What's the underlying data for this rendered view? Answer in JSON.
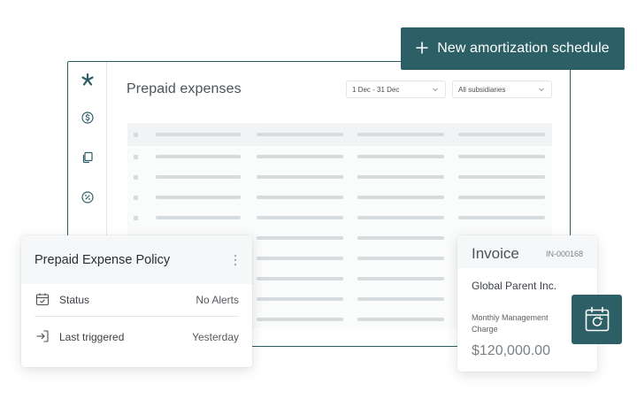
{
  "header": {
    "cta_label": "New amortization schedule",
    "cta_icon": "plus-icon",
    "accent_color": "#2c5f66"
  },
  "sidebar": {
    "items": [
      {
        "icon": "asterisk-logo-icon"
      },
      {
        "icon": "dollar-circle-icon"
      },
      {
        "icon": "copy-icon"
      },
      {
        "icon": "percent-circle-icon"
      }
    ]
  },
  "main": {
    "title": "Prepaid expenses",
    "date_filter": "1 Dec - 31 Dec",
    "subsidiary_filter": "All subsidiaries"
  },
  "policy_card": {
    "title": "Prepaid Expense Policy",
    "rows": [
      {
        "label": "Status",
        "value": "No Alerts",
        "icon": "calendar-check-icon"
      },
      {
        "label": "Last triggered",
        "value": "Yesterday",
        "icon": "sign-in-icon"
      }
    ]
  },
  "invoice_card": {
    "title": "Invoice",
    "id": "IN-000168",
    "company": "Global Parent Inc.",
    "description": "Monthly Management Charge",
    "amount": "$120,000.00"
  },
  "refresh_badge": {
    "icon": "calendar-refresh-icon"
  }
}
